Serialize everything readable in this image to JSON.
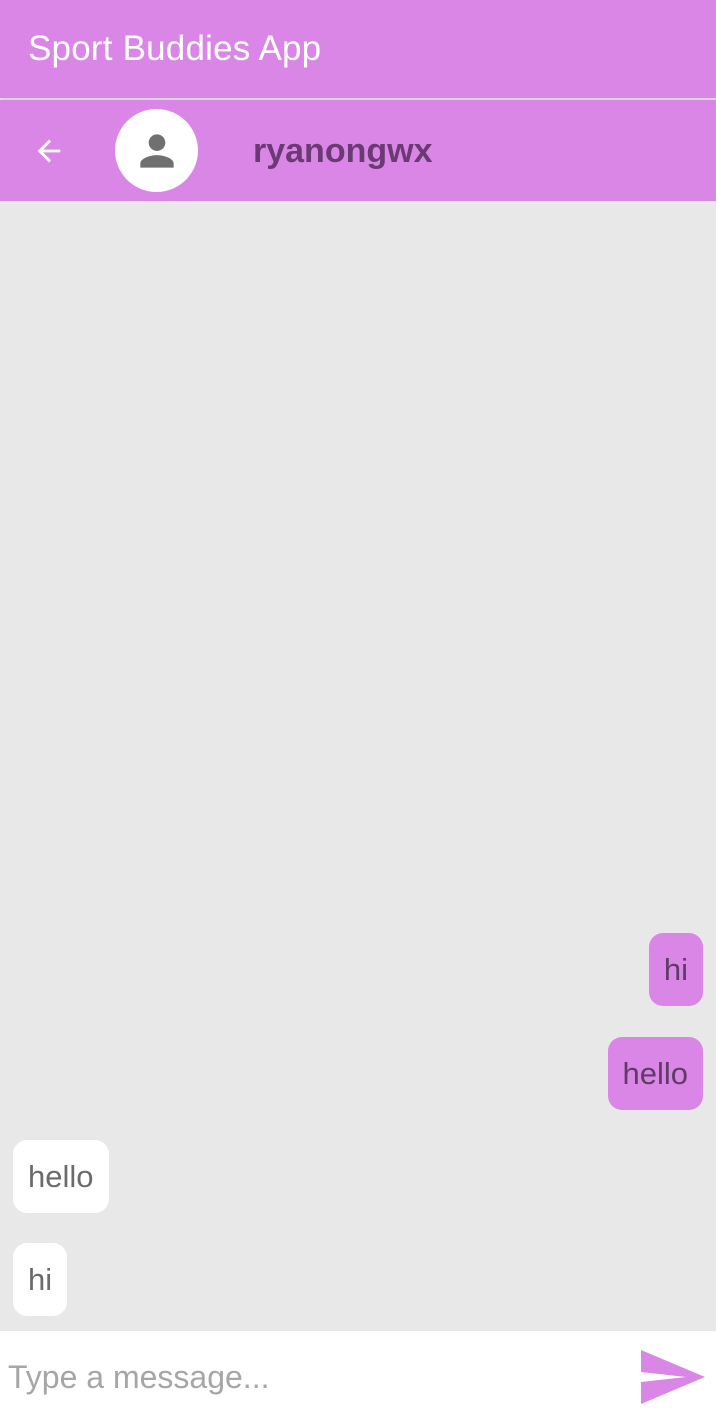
{
  "app": {
    "title": "Sport Buddies App"
  },
  "chat_header": {
    "contact_name": "ryanongwx",
    "icons": {
      "back": "arrow-back-icon",
      "avatar": "person-icon"
    }
  },
  "messages": [
    {
      "text": "hi",
      "direction": "sent"
    },
    {
      "text": "hello",
      "direction": "sent"
    },
    {
      "text": "hello",
      "direction": "received"
    },
    {
      "text": "hi",
      "direction": "received"
    }
  ],
  "composer": {
    "placeholder": "Type a message...",
    "value": "",
    "send_icon": "send-icon"
  },
  "colors": {
    "accent": "#da86e6",
    "chat_background": "#e8e8e8",
    "contact_name": "#6a3a72"
  }
}
